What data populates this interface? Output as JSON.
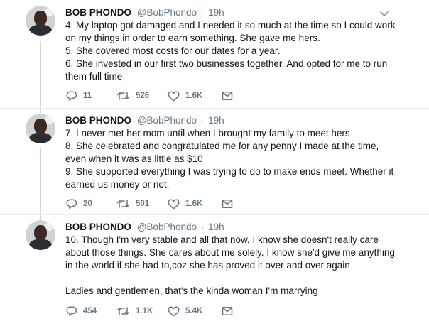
{
  "tweets": [
    {
      "author_name": "BOB PHONDO",
      "author_handle": "@BobPhondo",
      "separator": "·",
      "time": "19h",
      "paragraphs": [
        "4. My laptop got damaged and I needed it so much at the time so I could work on my things in order to earn something. She gave me hers.",
        "5. She covered most costs for our dates for a year.",
        "6. She invested in our first two businesses together. And opted for me to run them full time"
      ],
      "replies": "11",
      "retweets": "526",
      "likes": "1.6K"
    },
    {
      "author_name": "BOB PHONDO",
      "author_handle": "@BobPhondo",
      "separator": "·",
      "time": "19h",
      "paragraphs": [
        "7. I never met her mom until when I brought my family to meet hers",
        "8. She celebrated and congratulated me for any penny I made at the time, even when it was as little as $10",
        "9. She supported everything I was trying to do to make ends meet. Whether it earned us money or not."
      ],
      "replies": "20",
      "retweets": "501",
      "likes": "1.6K"
    },
    {
      "author_name": "BOB PHONDO",
      "author_handle": "@BobPhondo",
      "separator": "·",
      "time": "19h",
      "paragraphs": [
        "10. Though I'm very stable and all that now, I know she doesn't really care about those things. She cares about me solely. I know she'd give me anything in the world if she had to,coz she has proved it over and over again",
        "Ladies and gentlemen, that's the kinda woman I'm marrying"
      ],
      "replies": "454",
      "retweets": "1.1K",
      "likes": "5.4K"
    }
  ],
  "icons": {
    "reply": "reply-icon",
    "retweet": "retweet-icon",
    "like": "heart-icon",
    "dm": "envelope-icon",
    "menu": "chevron-down-icon"
  },
  "colors": {
    "text": "#14171a",
    "secondary": "#657786",
    "thread_line": "#ccd6dd",
    "divider": "#e6ecf0"
  }
}
